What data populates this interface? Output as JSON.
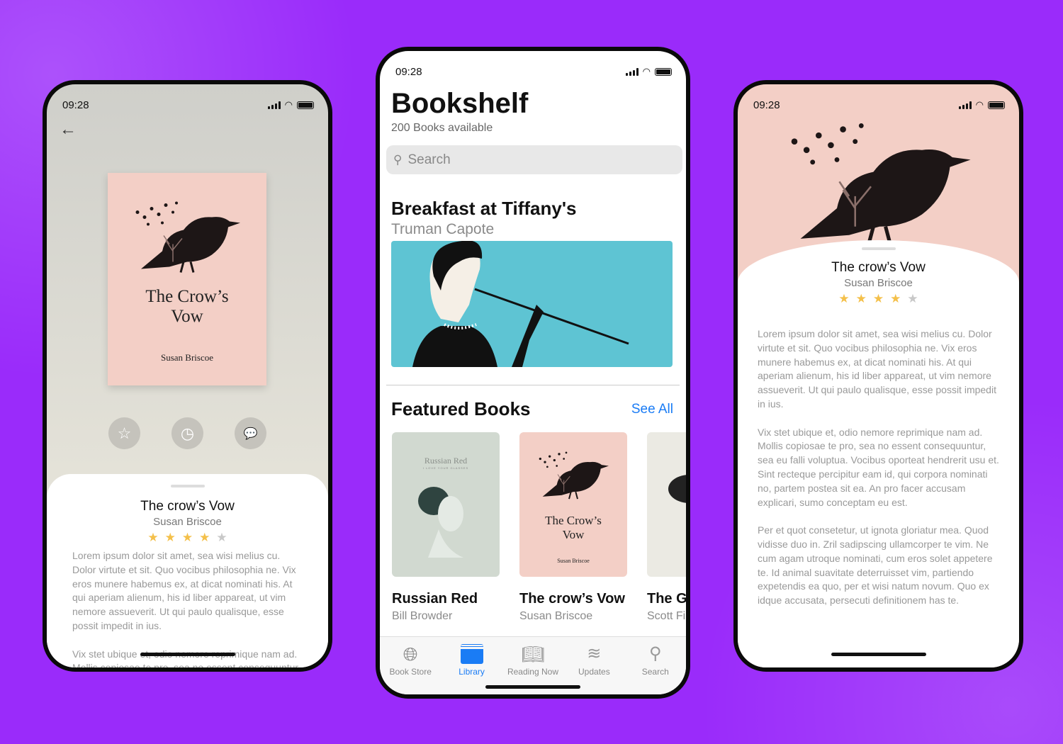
{
  "colors": {
    "background": "#9a2bfa",
    "accent": "#1a7cf5",
    "cover_pink": "#f3cfc6",
    "star_on": "#f4c04a",
    "star_off": "#c8c8c8"
  },
  "status_time": "09:28",
  "left_phone": {
    "back_icon": "arrow-left-icon",
    "cover": {
      "title_line1": "The Crow’s",
      "title_line2": "Vow",
      "author": "Susan Briscoe"
    },
    "actions": [
      {
        "icon": "star-icon"
      },
      {
        "icon": "timer-icon"
      },
      {
        "icon": "comment-icon"
      }
    ],
    "title": "The crow’s Vow",
    "author": "Susan Briscoe",
    "rating": 4,
    "rating_max": 5,
    "paragraphs": [
      "Lorem ipsum dolor sit amet, sea wisi melius cu. Dolor virtute et sit. Quo vocibus philosophia ne. Vix eros munere habemus ex, at dicat nominati his. At qui aperiam alienum, his id liber appareat, ut vim nemore assueverit. Ut qui paulo qualisque, esse possit impedit in ius.",
      "Vix stet ubique et, odio nemore reprimique nam ad. Mollis copiosae te pro, sea no essent consequuntur,"
    ]
  },
  "center_phone": {
    "title": "Bookshelf",
    "subtitle": "200 Books available",
    "search_placeholder": "Search",
    "hero": {
      "title": "Breakfast at Tiffany's",
      "author": "Truman Capote"
    },
    "featured": {
      "heading": "Featured Books",
      "see_all": "See All",
      "books": [
        {
          "title": "Russian Red",
          "author": "Bill Browder",
          "cover_title": "Russian Red",
          "cover_sub": "I LOVE YOUR GLASSES"
        },
        {
          "title": "The crow’s Vow",
          "author": "Susan Briscoe",
          "cover_title1": "The Crow’s",
          "cover_title2": "Vow",
          "cover_author": "Susan Briscoe"
        },
        {
          "title": "The Gr",
          "author": "Scott Fi"
        }
      ]
    },
    "tabs": [
      {
        "label": "Book Store",
        "icon": "globe-icon"
      },
      {
        "label": "Library",
        "icon": "library-icon",
        "active": true
      },
      {
        "label": "Reading Now",
        "icon": "book-open-icon"
      },
      {
        "label": "Updates",
        "icon": "layers-icon"
      },
      {
        "label": "Search",
        "icon": "search-icon"
      }
    ]
  },
  "right_phone": {
    "title": "The crow’s Vow",
    "author": "Susan Briscoe",
    "rating": 4,
    "rating_max": 5,
    "paragraphs": [
      "Lorem ipsum dolor sit amet, sea wisi melius cu. Dolor virtute et sit. Quo vocibus philosophia ne. Vix eros munere habemus ex, at dicat nominati his. At qui aperiam alienum, his id liber appareat, ut vim nemore assueverit. Ut qui paulo qualisque, esse possit impedit in ius.",
      "Vix stet ubique et, odio nemore reprimique nam ad. Mollis copiosae te pro, sea no essent consequuntur, sea eu falli voluptua. Vocibus oporteat hendrerit usu et. Sint recteque percipitur eam id, qui corpora nominati no, partem postea sit ea. An pro facer accusam explicari, sumo conceptam eu est.",
      "Per et quot consetetur, ut ignota gloriatur mea. Quod vidisse duo in. Zril sadipscing ullamcorper te vim. Ne cum agam utroque nominati, cum eros solet appetere te. Id animal suavitate deterruisset vim, partiendo expetendis ea quo, per et wisi natum novum. Quo ex idque accusata, persecuti definitionem has te."
    ]
  }
}
